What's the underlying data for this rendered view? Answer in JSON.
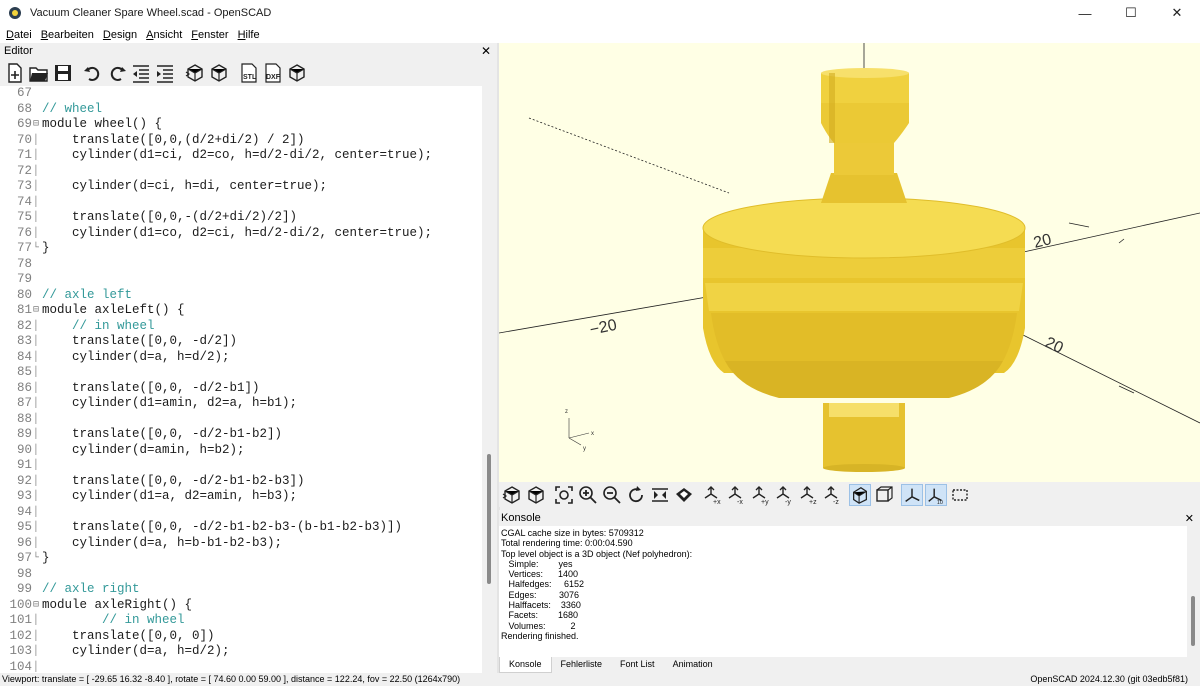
{
  "window": {
    "title": "Vacuum Cleaner Spare Wheel.scad - OpenSCAD",
    "controls": {
      "minimize": "—",
      "maximize": "☐",
      "close": "✕"
    }
  },
  "menu": [
    "Datei",
    "Bearbeiten",
    "Design",
    "Ansicht",
    "Fenster",
    "Hilfe"
  ],
  "editor": {
    "title": "Editor",
    "close": "✕",
    "toolbar": [
      {
        "name": "new-file-icon"
      },
      {
        "name": "open-file-icon"
      },
      {
        "name": "save-icon"
      },
      {
        "sep": true
      },
      {
        "name": "undo-icon"
      },
      {
        "name": "redo-icon"
      },
      {
        "name": "unindent-icon"
      },
      {
        "name": "indent-icon"
      },
      {
        "sep": true
      },
      {
        "name": "preview-icon"
      },
      {
        "name": "render-icon"
      },
      {
        "sep": true
      },
      {
        "name": "export-stl-icon",
        "label": "STL"
      },
      {
        "name": "export-dxf-icon",
        "label": "DXF"
      },
      {
        "name": "send-to-3d-print-icon"
      }
    ],
    "lines": [
      {
        "n": "67",
        "text": "",
        "fold": ""
      },
      {
        "n": "68",
        "text": "// wheel",
        "fold": "",
        "comment": true
      },
      {
        "n": "69",
        "text": "module wheel() {",
        "fold": "⊟"
      },
      {
        "n": "70",
        "text": "    translate([0,0,(d/2+di/2) / 2])",
        "fold": "│"
      },
      {
        "n": "71",
        "text": "    cylinder(d1=ci, d2=co, h=d/2-di/2, center=true);",
        "fold": "│"
      },
      {
        "n": "72",
        "text": "",
        "fold": "│"
      },
      {
        "n": "73",
        "text": "    cylinder(d=ci, h=di, center=true);",
        "fold": "│"
      },
      {
        "n": "74",
        "text": "",
        "fold": "│"
      },
      {
        "n": "75",
        "text": "    translate([0,0,-(d/2+di/2)/2])",
        "fold": "│"
      },
      {
        "n": "76",
        "text": "    cylinder(d1=co, d2=ci, h=d/2-di/2, center=true);",
        "fold": "│"
      },
      {
        "n": "77",
        "text": "}",
        "fold": "└"
      },
      {
        "n": "78",
        "text": "",
        "fold": ""
      },
      {
        "n": "79",
        "text": "",
        "fold": ""
      },
      {
        "n": "80",
        "text": "// axle left",
        "fold": "",
        "comment": true
      },
      {
        "n": "81",
        "text": "module axleLeft() {",
        "fold": "⊟"
      },
      {
        "n": "82",
        "text": "    // in wheel",
        "fold": "│",
        "comment": true
      },
      {
        "n": "83",
        "text": "    translate([0,0, -d/2])",
        "fold": "│"
      },
      {
        "n": "84",
        "text": "    cylinder(d=a, h=d/2);",
        "fold": "│"
      },
      {
        "n": "85",
        "text": "",
        "fold": "│"
      },
      {
        "n": "86",
        "text": "    translate([0,0, -d/2-b1])",
        "fold": "│"
      },
      {
        "n": "87",
        "text": "    cylinder(d1=amin, d2=a, h=b1);",
        "fold": "│"
      },
      {
        "n": "88",
        "text": "",
        "fold": "│"
      },
      {
        "n": "89",
        "text": "    translate([0,0, -d/2-b1-b2])",
        "fold": "│"
      },
      {
        "n": "90",
        "text": "    cylinder(d=amin, h=b2);",
        "fold": "│"
      },
      {
        "n": "91",
        "text": "",
        "fold": "│"
      },
      {
        "n": "92",
        "text": "    translate([0,0, -d/2-b1-b2-b3])",
        "fold": "│"
      },
      {
        "n": "93",
        "text": "    cylinder(d1=a, d2=amin, h=b3);",
        "fold": "│"
      },
      {
        "n": "94",
        "text": "",
        "fold": "│"
      },
      {
        "n": "95",
        "text": "    translate([0,0, -d/2-b1-b2-b3-(b-b1-b2-b3)])",
        "fold": "│"
      },
      {
        "n": "96",
        "text": "    cylinder(d=a, h=b-b1-b2-b3);",
        "fold": "│"
      },
      {
        "n": "97",
        "text": "}",
        "fold": "└"
      },
      {
        "n": "98",
        "text": "",
        "fold": ""
      },
      {
        "n": "99",
        "text": "// axle right",
        "fold": "",
        "comment": true
      },
      {
        "n": "100",
        "text": "module axleRight() {",
        "fold": "⊟"
      },
      {
        "n": "101",
        "text": "        // in wheel",
        "fold": "│",
        "comment": true
      },
      {
        "n": "102",
        "text": "    translate([0,0, 0])",
        "fold": "│"
      },
      {
        "n": "103",
        "text": "    cylinder(d=a, h=d/2);",
        "fold": "│"
      },
      {
        "n": "104",
        "text": "",
        "fold": "│"
      }
    ]
  },
  "viewport": {
    "background": "#ffffe5",
    "model_color": "#f3d43c",
    "axis_labels": [
      "−20",
      "20",
      "20"
    ],
    "orientation_axes": [
      "z",
      "y",
      "x"
    ]
  },
  "view_toolbar": [
    {
      "name": "preview-icon"
    },
    {
      "name": "render-icon"
    },
    {
      "sep": true
    },
    {
      "name": "view-all-icon"
    },
    {
      "name": "zoom-in-icon"
    },
    {
      "name": "zoom-out-icon"
    },
    {
      "name": "reset-view-icon"
    },
    {
      "name": "view-mirror-icon"
    },
    {
      "name": "surface-icon"
    },
    {
      "sep": true
    },
    {
      "name": "view-right-icon",
      "label": "+x"
    },
    {
      "name": "view-left-icon",
      "label": "-x"
    },
    {
      "name": "view-back-icon",
      "label": "+y"
    },
    {
      "name": "view-front-icon",
      "label": "-y"
    },
    {
      "name": "view-top-icon",
      "label": "+z"
    },
    {
      "name": "view-bottom-icon",
      "label": "-z"
    },
    {
      "sep": true
    },
    {
      "name": "perspective-icon",
      "active": true
    },
    {
      "name": "orthogonal-icon"
    },
    {
      "sep": true
    },
    {
      "name": "show-axes-icon",
      "active": true
    },
    {
      "name": "show-scale-markers-icon",
      "active": true
    },
    {
      "name": "show-edges-icon"
    }
  ],
  "console": {
    "title": "Konsole",
    "close": "✕",
    "lines": [
      "CGAL cache size in bytes: 5709312",
      "Total rendering time: 0:00:04.590",
      "Top level object is a 3D object (Nef polyhedron):",
      "   Simple:        yes",
      "   Vertices:      1400",
      "   Halfedges:     6152",
      "   Edges:         3076",
      "   Halffacets:    3360",
      "   Facets:        1680",
      "   Volumes:          2",
      "Rendering finished."
    ]
  },
  "bottom_tabs": [
    "Konsole",
    "Fehlerliste",
    "Font List",
    "Animation"
  ],
  "status": {
    "viewport": "Viewport: translate = [ -29.65 16.32 -8.40 ], rotate = [ 74.60 0.00 59.00 ], distance = 122.24, fov = 22.50 (1264x790)",
    "version": "OpenSCAD 2024.12.30 (git 03edb5f81)"
  }
}
